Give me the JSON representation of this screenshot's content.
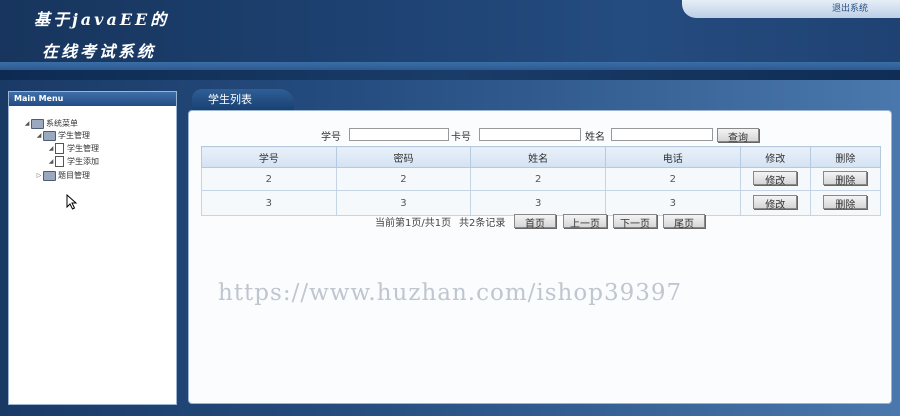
{
  "header": {
    "title_line1": "基于javaEE的",
    "title_line2": "在线考试系统",
    "logout_label": "退出系统"
  },
  "sidebar": {
    "title": "Main Menu",
    "tree": {
      "root": "系统菜单",
      "student_mgmt": "学生管理",
      "student_list": "学生管理",
      "student_add": "学生添加",
      "question_mgmt": "题目管理"
    }
  },
  "tab": {
    "label": "学生列表"
  },
  "search": {
    "id_label": "学号",
    "card_label": "卡号",
    "name_label": "姓名",
    "id_value": "",
    "card_value": "",
    "name_value": "",
    "button": "查询"
  },
  "table": {
    "headers": [
      "学号",
      "密码",
      "姓名",
      "电话",
      "修改",
      "删除"
    ],
    "rows": [
      {
        "id": "2",
        "password": "2",
        "name": "2",
        "phone": "2",
        "edit": "修改",
        "delete": "删除"
      },
      {
        "id": "3",
        "password": "3",
        "name": "3",
        "phone": "3",
        "edit": "修改",
        "delete": "删除"
      }
    ]
  },
  "pager": {
    "status": "当前第1页/共1页",
    "total": "共2条记录",
    "first": "首页",
    "prev": "上一页",
    "next": "下一页",
    "last": "尾页"
  },
  "watermark": "https://www.huzhan.com/ishop39397",
  "icons": [
    "folder-icon",
    "document-icon",
    "expand-arrow-icon",
    "mouse-cursor-icon"
  ],
  "colors": {
    "header_bg": "#1e4374",
    "panel_border": "#9bb4d1",
    "header_row": "#d3e2f2"
  }
}
